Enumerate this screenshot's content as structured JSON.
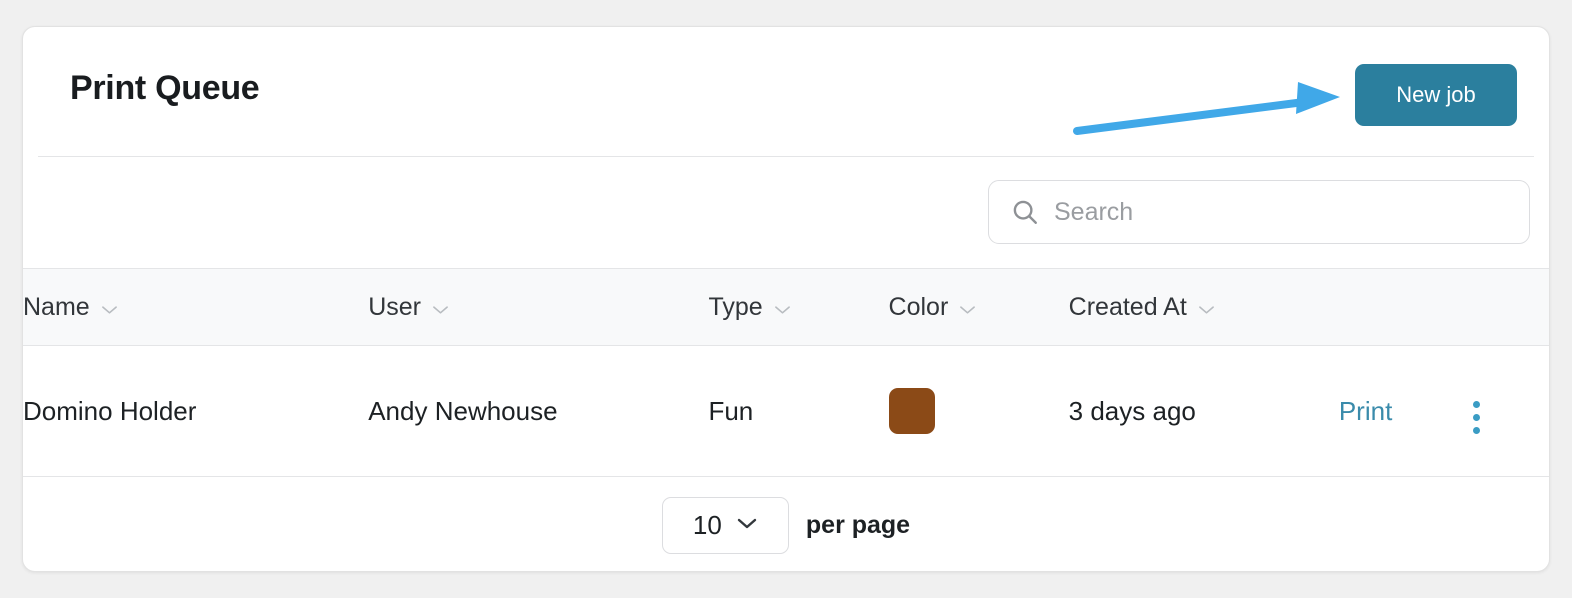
{
  "header": {
    "title": "Print Queue",
    "new_job_label": "New job"
  },
  "annotation": {
    "type": "arrow",
    "color": "#40a8e8",
    "points_to": "new-job-button"
  },
  "search": {
    "value": "",
    "placeholder": "Search",
    "icon": "search-icon"
  },
  "table": {
    "columns": [
      {
        "label": "Name",
        "sort_icon": "chevron-down-icon"
      },
      {
        "label": "User",
        "sort_icon": "chevron-down-icon"
      },
      {
        "label": "Type",
        "sort_icon": "chevron-down-icon"
      },
      {
        "label": "Color",
        "sort_icon": "chevron-down-icon"
      },
      {
        "label": "Created At",
        "sort_icon": "chevron-down-icon"
      }
    ],
    "rows": [
      {
        "name": "Domino Holder",
        "user": "Andy Newhouse",
        "type": "Fun",
        "color": "#8b4a17",
        "created_at": "3 days ago",
        "action_label": "Print",
        "menu_icon": "kebab-menu-icon"
      }
    ]
  },
  "footer": {
    "per_page_value": "10",
    "per_page_label": "per page",
    "chevron_icon": "chevron-down-icon"
  },
  "colors": {
    "accent_button": "#2b7f9e",
    "link": "#3a8bab",
    "annotation_arrow": "#40a8e8",
    "swatch_brown": "#8b4a17",
    "page_bg": "#f0f0f0",
    "header_row_bg": "#f8f9fa"
  }
}
